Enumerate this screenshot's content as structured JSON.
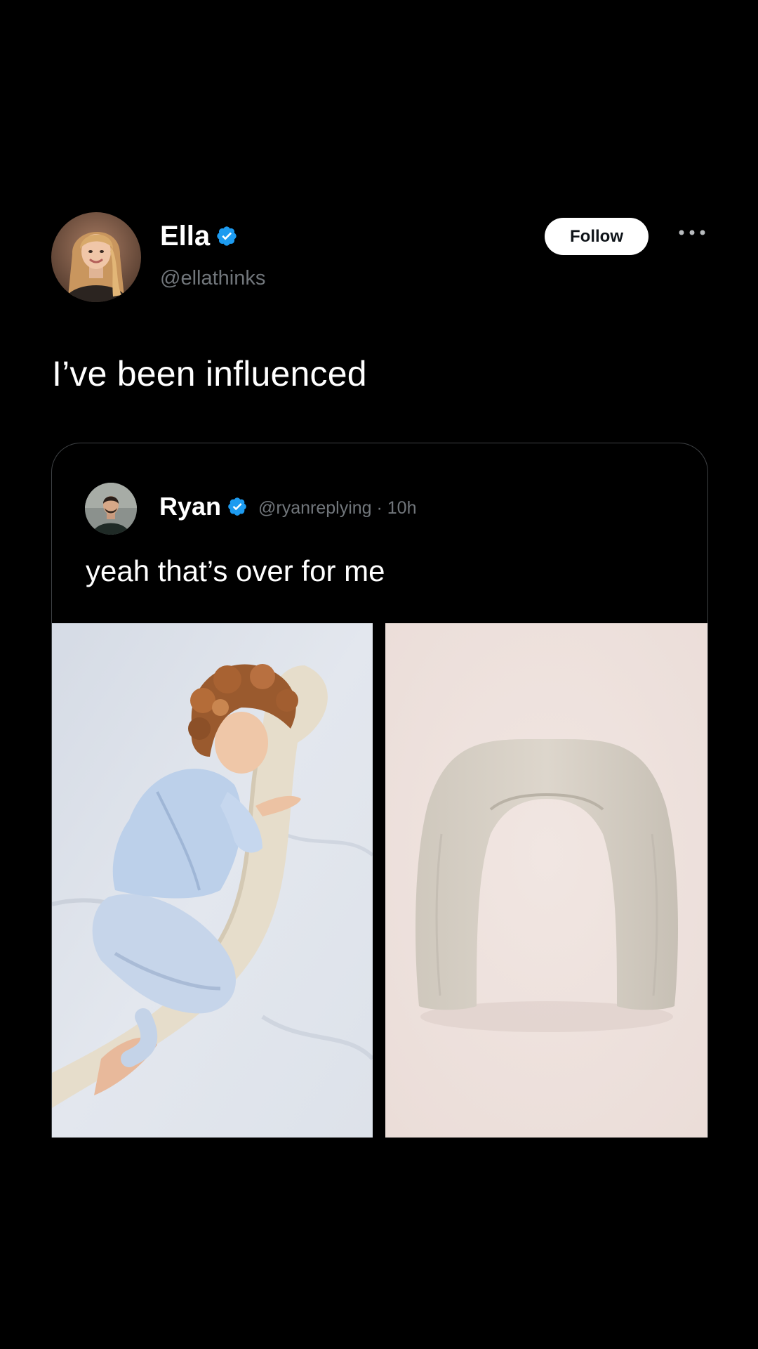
{
  "post": {
    "author": {
      "name": "Ella",
      "handle": "@ellathinks",
      "verified": true
    },
    "follow_label": "Follow",
    "text": "I’ve been influenced"
  },
  "quoted": {
    "author": {
      "name": "Ryan",
      "handle": "@ryanreplying",
      "separator": " · ",
      "time": "10h",
      "verified": true
    },
    "text": "yeah that’s over for me"
  },
  "icons": {
    "verified": "verified-badge-icon",
    "more": "more-horizontal-icon"
  },
  "colors": {
    "background": "#000000",
    "text": "#ffffff",
    "secondary_text": "#71767b",
    "verified_blue": "#1d9bf0",
    "card_border": "#3e4144"
  }
}
